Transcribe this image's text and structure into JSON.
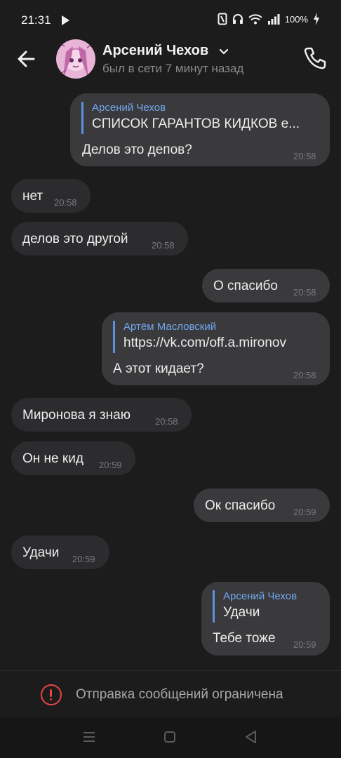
{
  "status_bar": {
    "time": "21:31",
    "battery": "100%",
    "icons": [
      "play-icon",
      "nfc-icon",
      "headset-icon",
      "wifi-icon",
      "signal-icon",
      "battery-icon",
      "charging-icon"
    ]
  },
  "header": {
    "name": "Арсений Чехов",
    "status": "был в сети 7 минут назад",
    "icons": [
      "back-arrow-icon",
      "avatar",
      "chevron-down-icon",
      "phone-icon"
    ]
  },
  "messages": [
    {
      "direction": "out",
      "reply_name": "Арсений Чехов",
      "reply_text": "СПИСОК ГАРАНТОВ КИДКОВ   е...",
      "text": "Делов это депов?",
      "time": "20:58"
    },
    {
      "direction": "in",
      "text": "нет",
      "time": "20:58"
    },
    {
      "direction": "in",
      "text": "делов это другой",
      "time": "20:58"
    },
    {
      "direction": "out",
      "text": "О спасибо",
      "time": "20:58"
    },
    {
      "direction": "out",
      "reply_name": "Артём Масловский",
      "reply_text": "https://vk.com/off.a.mironov",
      "text": "А этот кидает?",
      "time": "20:58"
    },
    {
      "direction": "in",
      "text": "Миронова я знаю",
      "time": "20:58"
    },
    {
      "direction": "in",
      "text": "Он не кид",
      "time": "20:59"
    },
    {
      "direction": "out",
      "text": "Ок спасибо",
      "time": "20:59"
    },
    {
      "direction": "in",
      "text": "Удачи",
      "time": "20:59"
    },
    {
      "direction": "out",
      "reply_name": "Арсений Чехов",
      "reply_text": "Удачи",
      "text": "Тебе тоже",
      "time": "20:59"
    }
  ],
  "footer": {
    "restriction_text": "Отправка сообщений ограничена",
    "icon": "alert-circle-icon",
    "accent_color": "#e64646"
  },
  "nav": {
    "icons": [
      "menu-icon",
      "home-icon",
      "back-icon"
    ]
  },
  "colors": {
    "background": "#1c1c1d",
    "incoming_bubble": "#2c2c2e",
    "outgoing_bubble": "#3a3a3c",
    "reply_accent": "#71a7ef"
  }
}
